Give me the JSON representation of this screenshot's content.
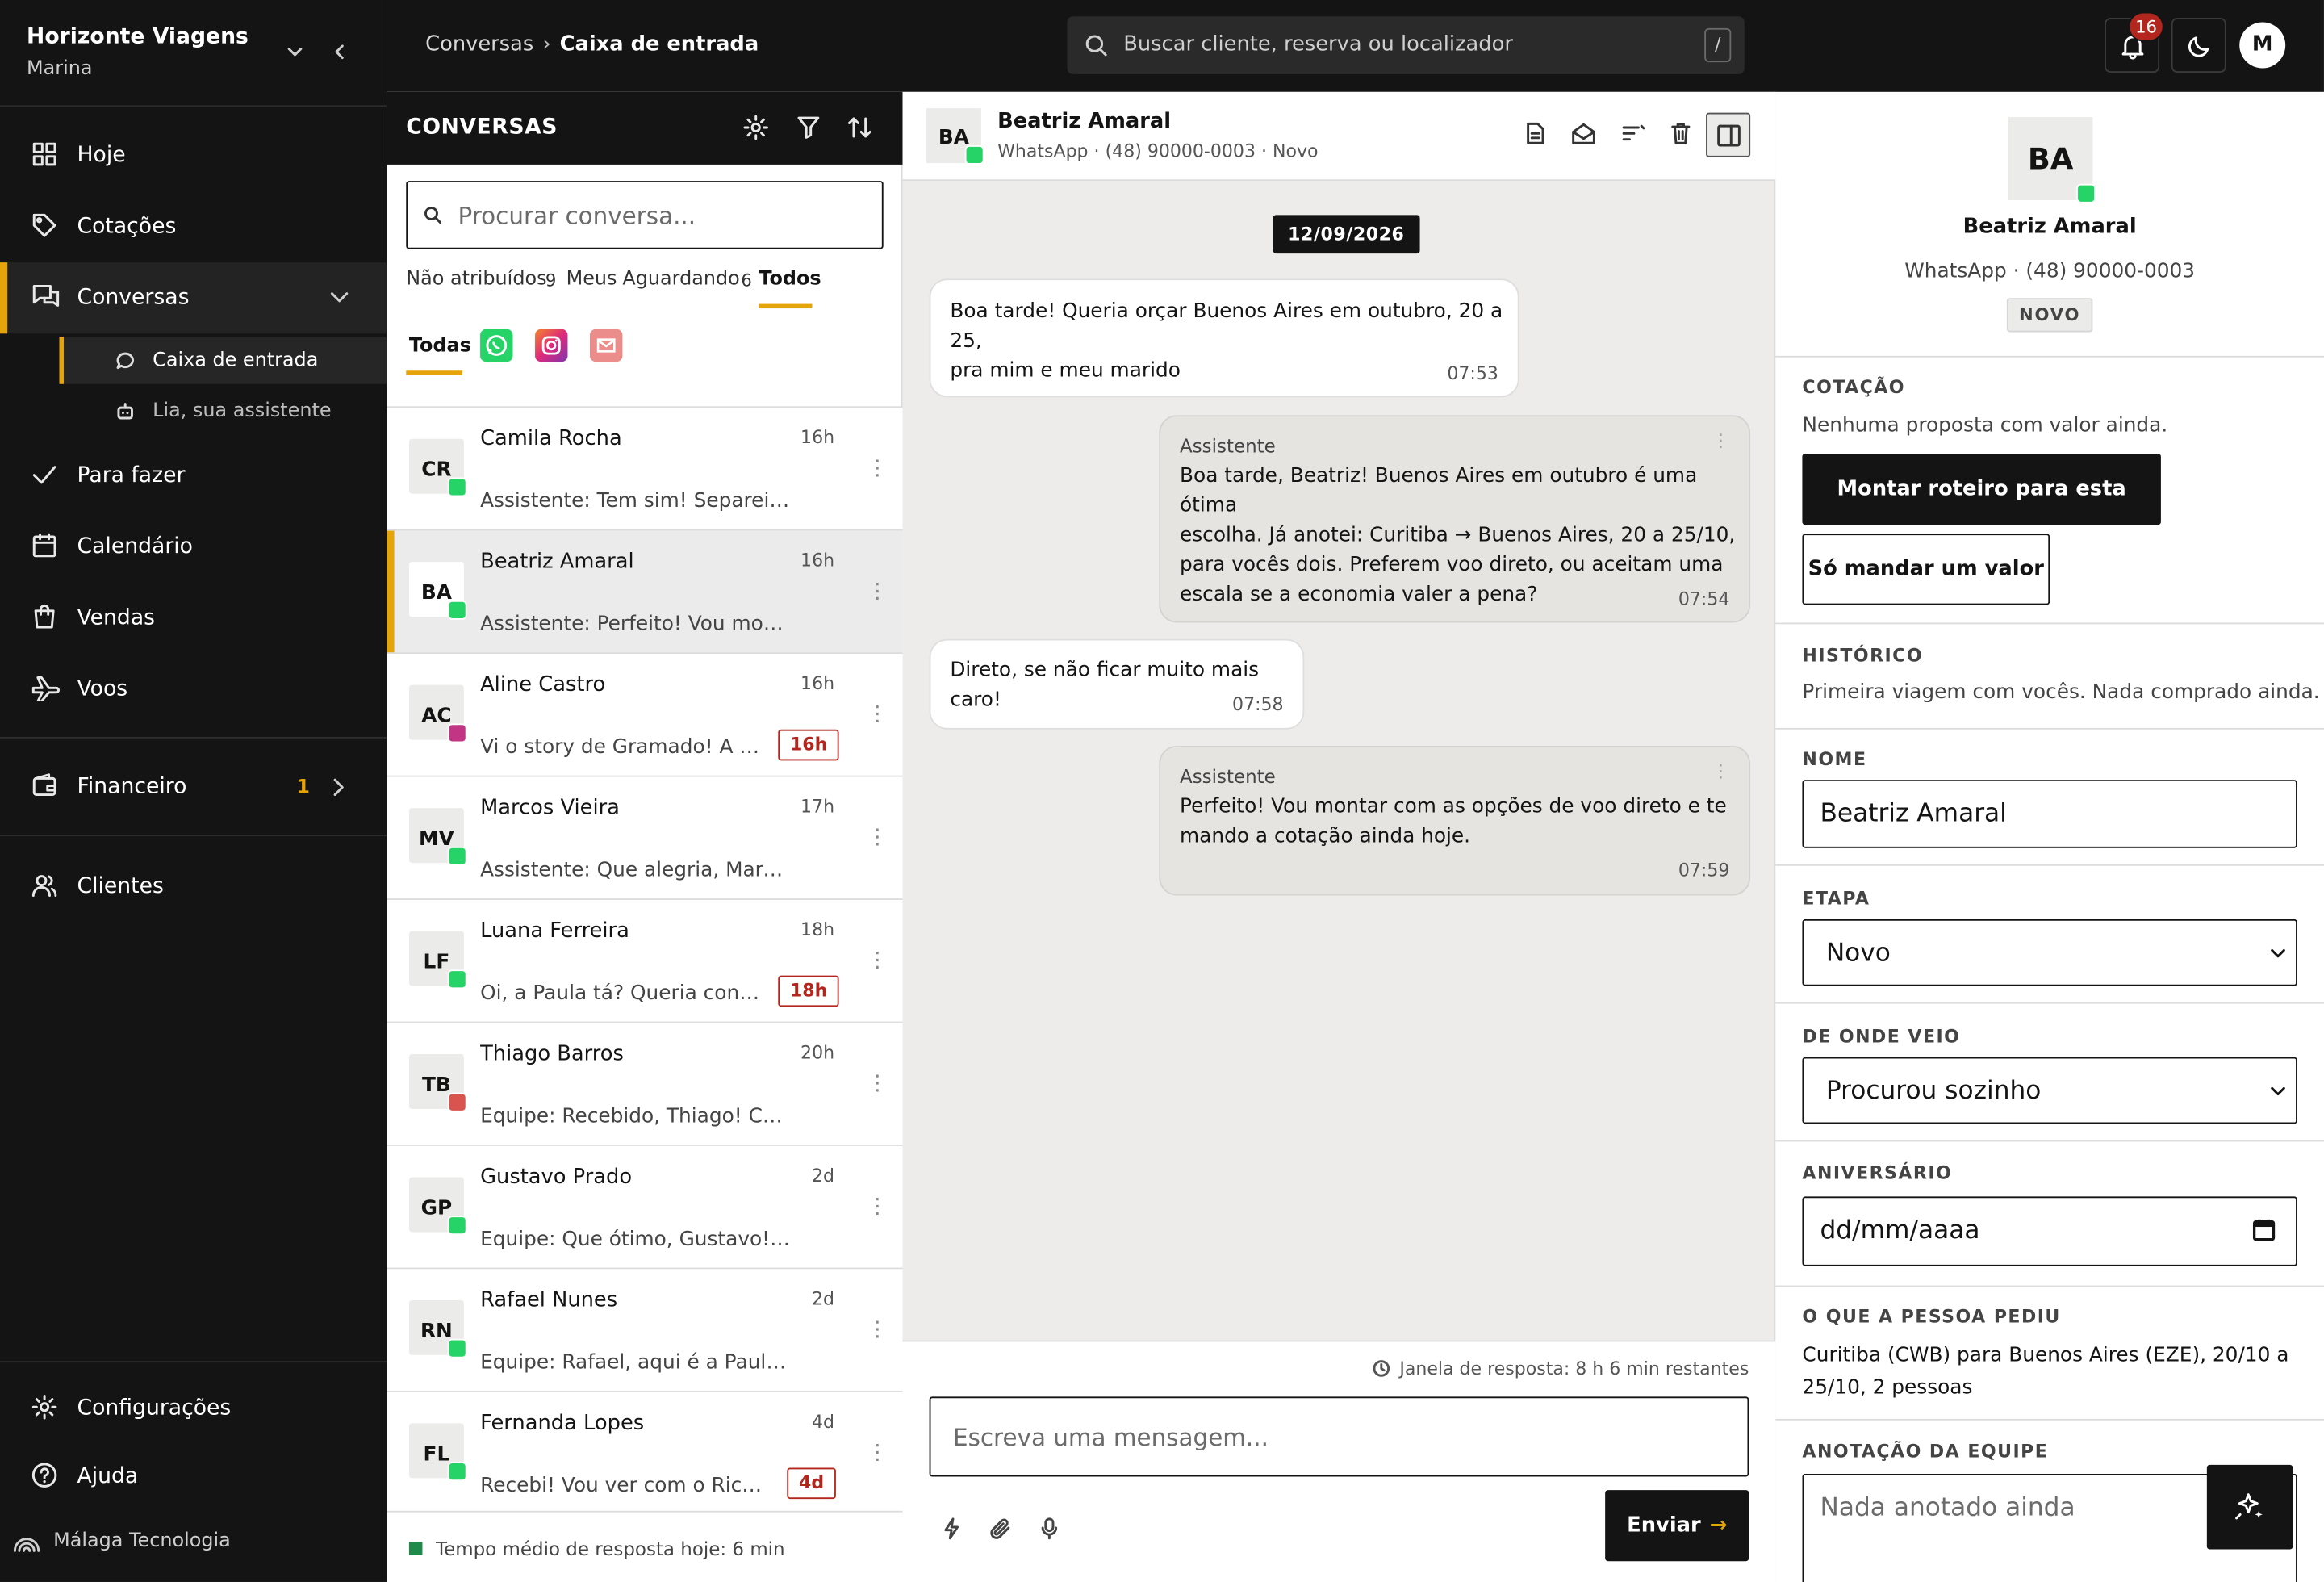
{
  "sidebar": {
    "company": "Horizonte Viagens",
    "user": "Marina",
    "nav": [
      {
        "label": "Hoje",
        "icon": "grid-icon"
      },
      {
        "label": "Cotações",
        "icon": "tag-icon"
      },
      {
        "label": "Conversas",
        "icon": "chat-bubbles-icon"
      },
      {
        "label": "Para fazer",
        "icon": "check-icon"
      },
      {
        "label": "Calendário",
        "icon": "calendar-icon"
      },
      {
        "label": "Vendas",
        "icon": "shopping-bag-icon"
      },
      {
        "label": "Voos",
        "icon": "plane-icon"
      },
      {
        "label": "Financeiro",
        "icon": "wallet-icon",
        "badge": "1"
      },
      {
        "label": "Clientes",
        "icon": "users-icon"
      }
    ],
    "subnav": [
      {
        "label": "Caixa de entrada",
        "icon": "chat-bubble-icon"
      },
      {
        "label": "Lia, sua assistente",
        "icon": "robot-icon"
      }
    ],
    "bottom": [
      {
        "label": "Configurações",
        "icon": "gear-icon"
      },
      {
        "label": "Ajuda",
        "icon": "help-icon"
      }
    ],
    "footer": "Málaga Tecnologia"
  },
  "topbar": {
    "breadcrumb_parent": "Conversas",
    "breadcrumb_sep": "›",
    "breadcrumb_current": "Caixa de entrada",
    "search_placeholder": "Buscar cliente, reserva ou localizador",
    "search_shortcut": "/",
    "notifications_count": "16",
    "avatar_initial": "M"
  },
  "conversations": {
    "title": "CONVERSAS",
    "search_placeholder": "Procurar conversa...",
    "filters": [
      {
        "label": "Não atribuídos",
        "count": "9"
      },
      {
        "label": "Meus",
        "count": ""
      },
      {
        "label": "Aguardando",
        "count": "6"
      },
      {
        "label": "Todos",
        "count": ""
      }
    ],
    "channel_all": "Todas",
    "channels": [
      {
        "name": "whatsapp",
        "color": "#25d366"
      },
      {
        "name": "instagram",
        "color": "#c13584"
      },
      {
        "name": "email",
        "color": "#ea8d8b"
      }
    ],
    "items": [
      {
        "initials": "CR",
        "name": "Camila Rocha",
        "time": "16h",
        "preview": "Assistente: Tem sim! Separei duas opções",
        "channel": "whatsapp",
        "sla": ""
      },
      {
        "initials": "BA",
        "name": "Beatriz Amaral",
        "time": "16h",
        "preview": "Assistente: Perfeito! Vou montar com as opções",
        "channel": "whatsapp",
        "sla": ""
      },
      {
        "initials": "AC",
        "name": "Aline Castro",
        "time": "16h",
        "preview": "Vi o story de Gramado! A cotação",
        "channel": "instagram",
        "sla": "16h"
      },
      {
        "initials": "MV",
        "name": "Marcos Vieira",
        "time": "17h",
        "preview": "Assistente: Que alegria, Marcos! Boa viagem",
        "channel": "whatsapp",
        "sla": ""
      },
      {
        "initials": "LF",
        "name": "Luana Ferreira",
        "time": "18h",
        "preview": "Oi, a Paula tá? Queria confirmar",
        "channel": "whatsapp",
        "sla": "18h"
      },
      {
        "initials": "TB",
        "name": "Thiago Barros",
        "time": "20h",
        "preview": "Equipe: Recebido, Thiago! Conferimos tudo",
        "channel": "email",
        "sla": ""
      },
      {
        "initials": "GP",
        "name": "Gustavo Prado",
        "time": "2d",
        "preview": "Equipe: Que ótimo, Gustavo! PIX recebido",
        "channel": "whatsapp",
        "sla": ""
      },
      {
        "initials": "RN",
        "name": "Rafael Nunes",
        "time": "2d",
        "preview": "Equipe: Rafael, aqui é a Paula, da agência",
        "channel": "whatsapp",
        "sla": ""
      },
      {
        "initials": "FL",
        "name": "Fernanda Lopes",
        "time": "4d",
        "preview": "Recebi! Vou ver com o Ricardo e te falo",
        "channel": "whatsapp",
        "sla": "4d"
      }
    ],
    "footer": "Tempo médio de resposta hoje: 6 min"
  },
  "chat": {
    "initials": "BA",
    "name": "Beatriz Amaral",
    "subtitle": "WhatsApp · (48) 90000-0003 · Novo",
    "date": "12/09/2026",
    "messages": [
      {
        "direction": "in",
        "author": "",
        "lines": [
          "Boa tarde! Queria orçar Buenos Aires em outubro, 20 a 25,",
          "pra mim e meu marido"
        ],
        "time": "07:53"
      },
      {
        "direction": "out",
        "author": "Assistente",
        "lines": [
          "Boa tarde, Beatriz! Buenos Aires em outubro é uma ótima",
          "escolha. Já anotei: Curitiba → Buenos Aires, 20 a 25/10,",
          "para vocês dois. Preferem voo direto, ou aceitam uma",
          "escala se a economia valer a pena?"
        ],
        "time": "07:54"
      },
      {
        "direction": "in",
        "author": "",
        "lines": [
          "Direto, se não ficar muito mais caro!"
        ],
        "time": "07:58"
      },
      {
        "direction": "out",
        "author": "Assistente",
        "lines": [
          "Perfeito! Vou montar com as opções de voo direto e te",
          "mando a cotação ainda hoje."
        ],
        "time": "07:59"
      }
    ],
    "reply_window": "Janela de resposta: 8 h 6 min restantes",
    "input_placeholder": "Escreva uma mensagem...",
    "send_label": "Enviar",
    "send_arrow": "→"
  },
  "details": {
    "initials": "BA",
    "name": "Beatriz Amaral",
    "phone": "WhatsApp · (48) 90000-0003",
    "stage_badge": "NOVO",
    "quote_label": "COTAÇÃO",
    "quote_text": "Nenhuma proposta com valor ainda.",
    "primary_button": "Montar roteiro para esta pessoa",
    "secondary_button": "Só mandar um valor",
    "history_label": "HISTÓRICO",
    "history_text": "Primeira viagem com vocês. Nada comprado ainda.",
    "name_label": "NOME",
    "name_value": "Beatriz Amaral",
    "stage_label": "ETAPA",
    "stage_value": "Novo",
    "source_label": "DE ONDE VEIO",
    "source_value": "Procurou sozinho",
    "birthday_label": "ANIVERSÁRIO",
    "birthday_placeholder": "dd/mm/aaaa",
    "request_label": "O QUE A PESSOA PEDIU",
    "request_lines": [
      "Curitiba (CWB) para Buenos Aires (EZE), 20/10 a",
      "25/10, 2 pessoas"
    ],
    "team_note_label": "ANOTAÇÃO DA EQUIPE",
    "team_note_placeholder": "Nada anotado ainda"
  },
  "colors": {
    "accent": "#e5a50a",
    "dark": "#141414",
    "whatsapp": "#25d366",
    "instagram": "#c13584",
    "email": "#d9534f",
    "sla_red": "#b3261e"
  }
}
